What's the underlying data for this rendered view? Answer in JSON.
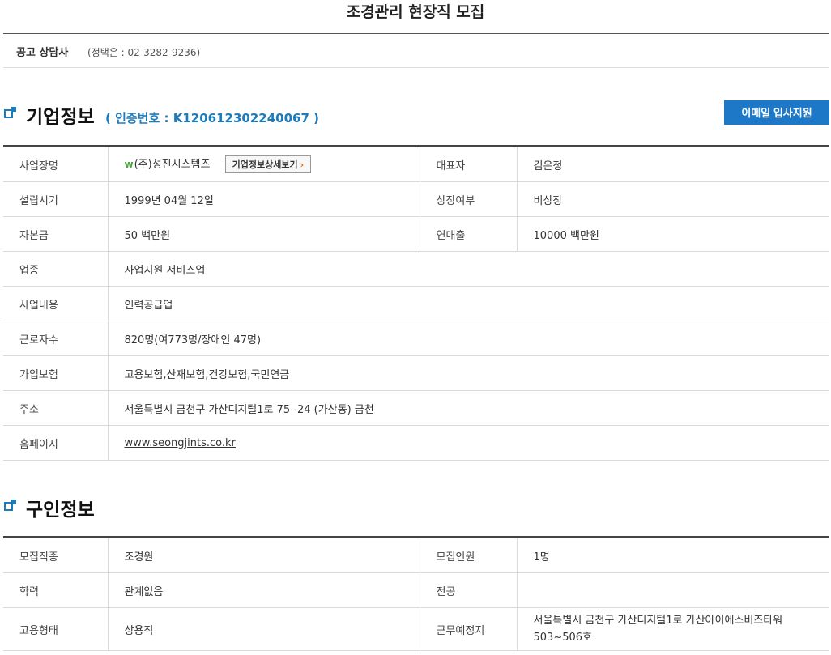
{
  "page_title": "조경관리 현장직 모집",
  "contact": {
    "label": "공고 상담사",
    "value": "(정택은 : 02-3282-9236)"
  },
  "company_section": {
    "title": "기업정보",
    "cert": "( 인증번호 : K120612302240067 )",
    "email_button": "이메일 입사지원",
    "detail_button": "기업정보상세보기",
    "rows": {
      "name_label": "사업장명",
      "name_logo": "w",
      "name_value": "(주)성진시스템즈",
      "ceo_label": "대표자",
      "ceo_value": "김은정",
      "founded_label": "설립시기",
      "founded_value": "1999년 04월 12일",
      "listed_label": "상장여부",
      "listed_value": "비상장",
      "capital_label": "자본금",
      "capital_value": "50 백만원",
      "sales_label": "연매출",
      "sales_value": "10000 백만원",
      "industry_label": "업종",
      "industry_value": "사업지원 서비스업",
      "business_label": "사업내용",
      "business_value": "인력공급업",
      "employees_label": "근로자수",
      "employees_value": "820명(여773명/장애인 47명)",
      "insurance_label": "가입보험",
      "insurance_value": "고용보험,산재보험,건강보험,국민연금",
      "address_label": "주소",
      "address_value": "서울특별시 금천구 가산디지털1로 75 -24 (가산동) 금천",
      "homepage_label": "홈페이지",
      "homepage_value": "www.seongjints.co.kr"
    }
  },
  "job_section": {
    "title": "구인정보",
    "rows": {
      "job_label": "모집직종",
      "job_value": "조경원",
      "count_label": "모집인원",
      "count_value": "1명",
      "edu_label": "학력",
      "edu_value": "관계없음",
      "major_label": "전공",
      "major_value": "",
      "type_label": "고용형태",
      "type_value": "상용직",
      "place_label": "근무예정지",
      "place_value": "서울특별시 금천구 가산디지털1로 가산아이에스비즈타워 503~506호"
    }
  }
}
